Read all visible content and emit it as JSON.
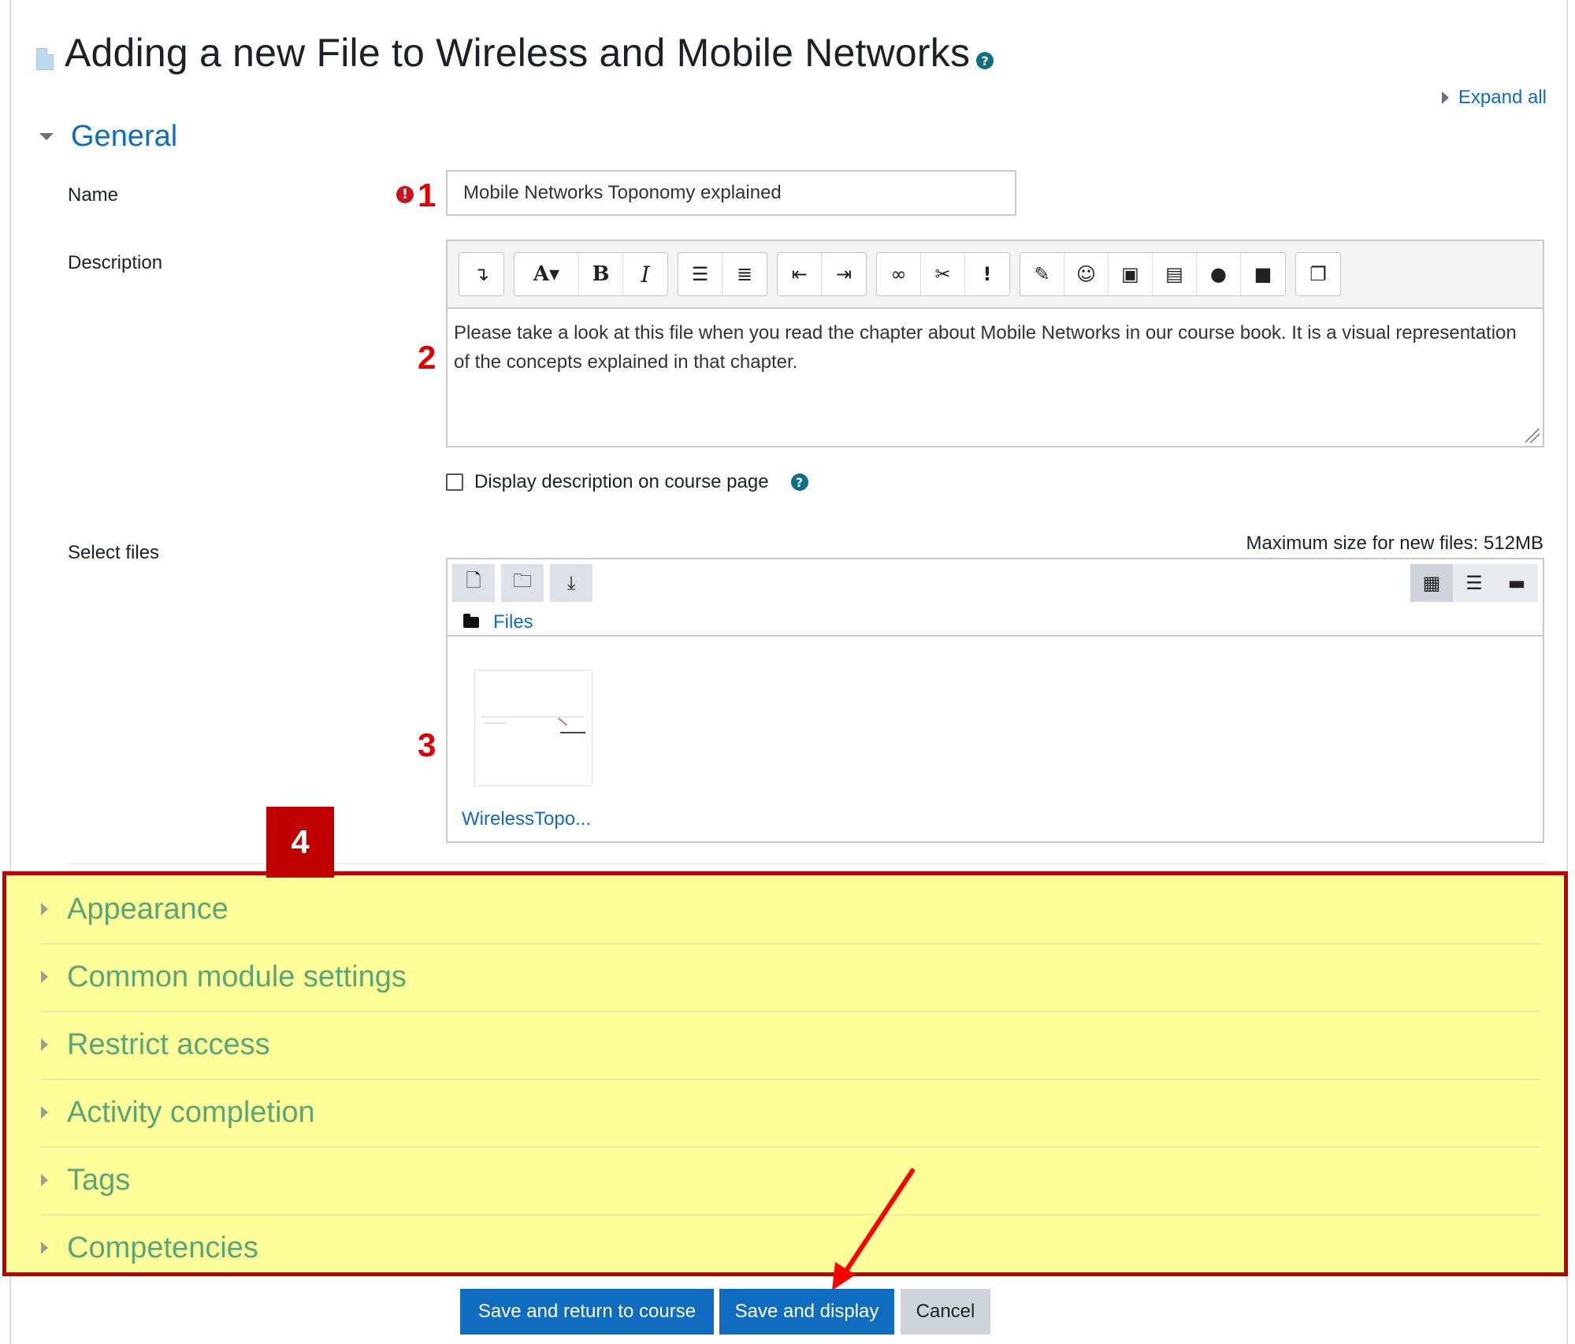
{
  "page": {
    "title": "Adding a new File to Wireless and Mobile Networks",
    "expand_all": "Expand all"
  },
  "general": {
    "section_label": "General",
    "name_label": "Name",
    "name_value": "Mobile Networks Toponomy explained",
    "description_label": "Description",
    "description_text": "Please take a look at this file when you read the chapter about Mobile Networks in our course book. It is a visual representation of the concepts explained in that chapter.",
    "display_description_label": "Display description on course page",
    "select_files_label": "Select files",
    "max_size_text": "Maximum size for new files: 512MB",
    "files_path_label": "Files",
    "file_name": "WirelessTopo..."
  },
  "editor_toolbar": {
    "groups": [
      [
        "toggle-toolbar-icon"
      ],
      [
        "font-style-icon",
        "bold-icon",
        "italic-icon"
      ],
      [
        "unordered-list-icon",
        "ordered-list-icon"
      ],
      [
        "outdent-icon",
        "indent-icon"
      ],
      [
        "link-icon",
        "unlink-icon",
        "accessibility-checker-icon"
      ],
      [
        "equation-editor-icon",
        "emoticon-icon",
        "image-icon",
        "media-icon",
        "record-audio-icon",
        "record-video-icon"
      ],
      [
        "manage-files-icon"
      ]
    ]
  },
  "collapsed_sections": [
    "Appearance",
    "Common module settings",
    "Restrict access",
    "Activity completion",
    "Tags",
    "Competencies"
  ],
  "callouts": {
    "one": "1",
    "two": "2",
    "three": "3",
    "four": "4"
  },
  "buttons": {
    "save_return": "Save and return to course",
    "save_display": "Save and display",
    "cancel": "Cancel"
  },
  "colors": {
    "link_blue": "#0f6cbf",
    "highlight_yellow": "#ffff99",
    "highlight_border_red": "#c00000",
    "callout_red": "#e00000",
    "section_green_text": "#5aa678"
  }
}
